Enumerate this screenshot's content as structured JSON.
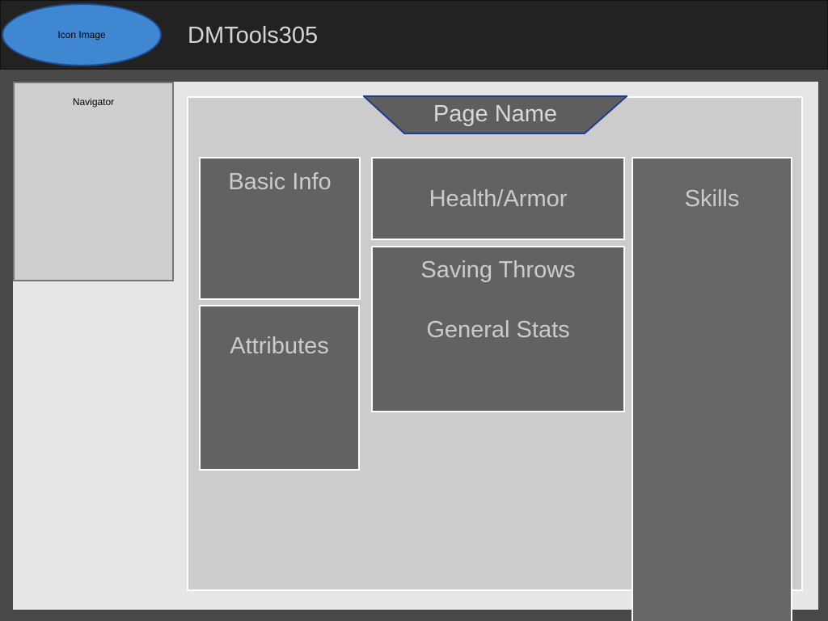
{
  "header": {
    "logo_label": "Icon Image",
    "app_title": "DMTools305"
  },
  "navigator": {
    "label": "Navigator"
  },
  "page": {
    "name": "Page Name"
  },
  "panels": {
    "basic_info": "Basic Info",
    "attributes": "Attributes",
    "health_armor": "Health/Armor",
    "saving_throws": "Saving Throws",
    "general_stats": "General Stats",
    "skills": "Skills"
  },
  "colors": {
    "background": "#484848",
    "header": "#222222",
    "logo_fill": "#3f87d0",
    "logo_border": "#1f4a90",
    "panel": "#626262",
    "panel_border": "#ffffff",
    "content": "#cccccc",
    "shell": "#e6e6e6"
  }
}
